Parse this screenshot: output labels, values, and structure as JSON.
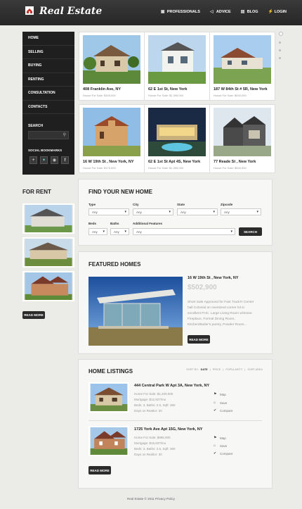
{
  "brand": {
    "name": "Real Estate"
  },
  "topnav": [
    {
      "label": "Professionals",
      "icon": "briefcase-icon"
    },
    {
      "label": "Advice",
      "icon": "megaphone-icon"
    },
    {
      "label": "Blog",
      "icon": "blog-icon"
    },
    {
      "label": "Login",
      "icon": "lightning-icon"
    }
  ],
  "sidebar": {
    "items": [
      "Home",
      "Selling",
      "Buying",
      "Renting",
      "Consultation",
      "Contacts"
    ],
    "search_label": "Search",
    "search_placeholder": "",
    "social_label": "Social Bookmarks",
    "social": [
      "plus-icon",
      "bird-icon",
      "globe-icon",
      "facebook-icon"
    ]
  },
  "listings": [
    {
      "addr": "408 Franklin Ave, NY",
      "price": "House For Sale: $345,000"
    },
    {
      "addr": "62 E 1st St, New York",
      "price": "House For Sale: $1,395,000"
    },
    {
      "addr": "187 W 84th St # 5R, New York",
      "price": "House For Sale: $540,000"
    },
    {
      "addr": "16 W 19th St , New York, NY",
      "price": "House For Sale: $175,000"
    },
    {
      "addr": "62 E 1st St Apt 4S, New York",
      "price": "House For Sale: $1,395,000"
    },
    {
      "addr": "77 Reade St , New York",
      "price": "House For Sale: $540,000"
    }
  ],
  "for_rent": {
    "title": "For Rent",
    "read_more": "Read More"
  },
  "find_home": {
    "title": "Find Your New Home",
    "fields": [
      {
        "label": "Type",
        "value": "Any"
      },
      {
        "label": "City",
        "value": "Any"
      },
      {
        "label": "State",
        "value": "Any"
      },
      {
        "label": "Zipcode",
        "value": "Any"
      },
      {
        "label": "Beds",
        "value": "Any"
      },
      {
        "label": "Baths",
        "value": "Any"
      },
      {
        "label": "Additional Features",
        "value": "Any"
      }
    ],
    "search_button": "Search"
  },
  "featured": {
    "title": "Featured Homes",
    "addr": "16 W 19th St , New York, NY",
    "price": "$502,900",
    "desc": "Short Sale Approved for Fast Track!!! Center hall Colonial on oversized corner lot in excellent FHC. Large Living Room w/Stone Fireplace, Formal Dining Room, Kitchen/Butler's pantry, Powder Room...",
    "read_more": "Read More"
  },
  "home_listings": {
    "title": "Home Listings",
    "sort_by": "Sort by:",
    "sort_options": [
      "Date",
      "Price",
      "Popularity",
      "Sort Area"
    ],
    "items": [
      {
        "addr": "444 Central Park W Apt 3A, New York, NY",
        "lines": [
          "Home For Sale: $1,200,000",
          "Mortgage: $12,927/mo",
          "Beds: 3, Baths: 2.5, Sqft: 360",
          "Days on Realtor: 30"
        ]
      },
      {
        "addr": "1725 York Ave Apt 15G, New York, NY",
        "lines": [
          "Home For Sale: $995,000",
          "Mortgage: $15,927/mo",
          "Beds: 3, Baths: 2.5, Sqft: 360",
          "Days on Realtor: 30"
        ]
      }
    ],
    "actions": [
      {
        "label": "Map",
        "icon": "map-pin-icon"
      },
      {
        "label": "Save",
        "icon": "save-icon"
      },
      {
        "label": "Compare",
        "icon": "check-icon"
      }
    ],
    "read_more": "Read More"
  },
  "footer": {
    "text": "Real Estate © 2011 Privacy Policy"
  },
  "colors": {
    "header": "#2a2a2a",
    "sidebar": "#1f1f1f",
    "page_bg": "#ebebe8",
    "button": "#2b2b2b"
  }
}
